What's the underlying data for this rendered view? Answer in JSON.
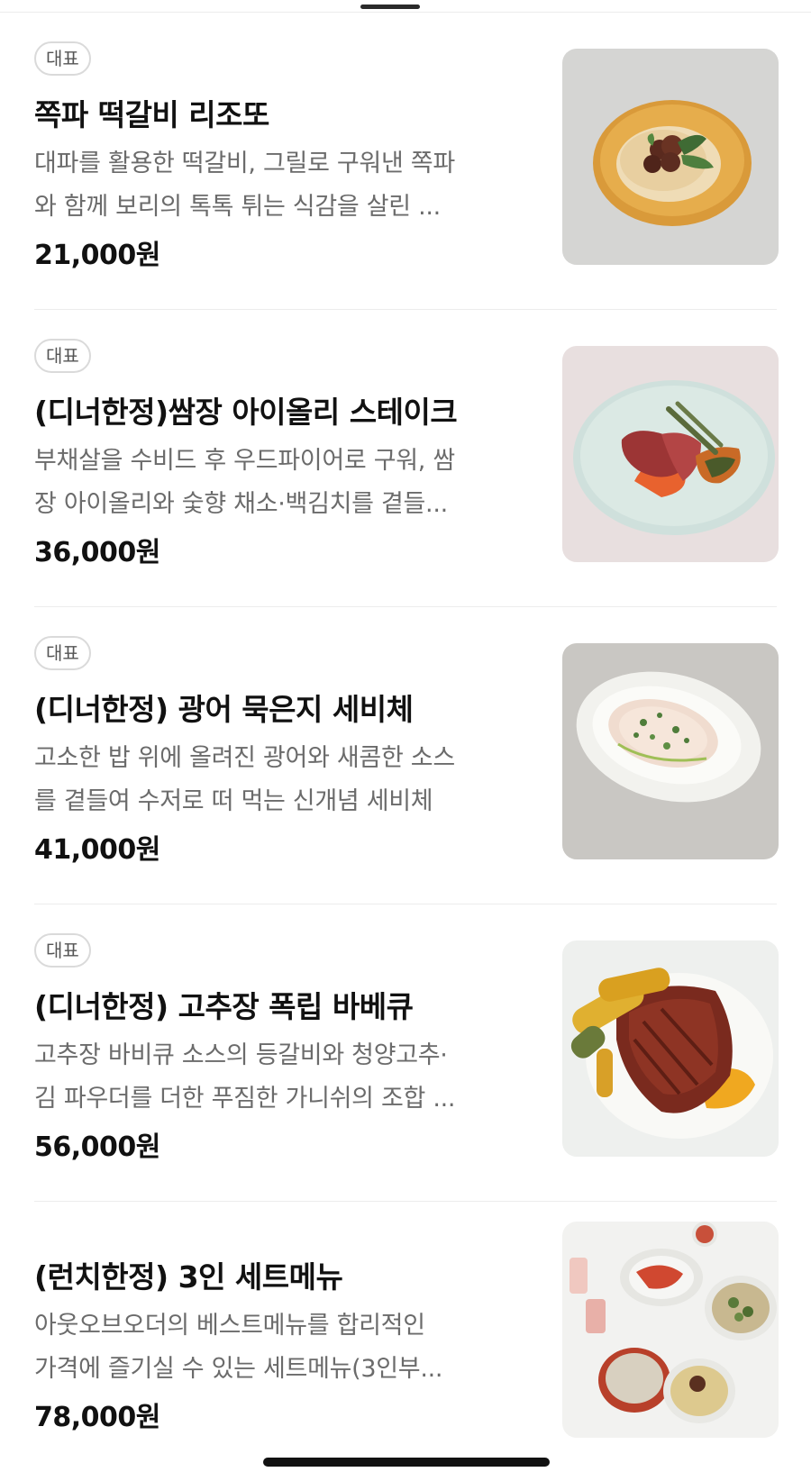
{
  "menu": {
    "items": [
      {
        "badge": "대표",
        "name": "쪽파 떡갈비 리조또",
        "desc_line1": "대파를 활용한 떡갈비, 그릴로 구워낸 쪽파",
        "desc_line2": "와 함께 보리의 톡톡 튀는 식감을 살린 ...",
        "price": "21,000원"
      },
      {
        "badge": "대표",
        "name": "(디너한정)쌈장 아이올리 스테이크",
        "desc_line1": "부채살을 수비드 후 우드파이어로 구워, 쌈",
        "desc_line2": "장 아이올리와 숯향 채소·백김치를 곁들...",
        "price": "36,000원"
      },
      {
        "badge": "대표",
        "name": "(디너한정) 광어 묵은지 세비체",
        "desc_line1": "고소한 밥 위에 올려진 광어와 새콤한 소스",
        "desc_line2": "를 곁들여 수저로 떠 먹는 신개념 세비체",
        "price": "41,000원"
      },
      {
        "badge": "대표",
        "name": "(디너한정) 고추장 폭립 바베큐",
        "desc_line1": "고추장 바비큐 소스의 등갈비와 청양고추·",
        "desc_line2": "김 파우더를 더한 푸짐한 가니쉬의 조합 ...",
        "price": "56,000원"
      },
      {
        "name": "(런치한정) 3인 세트메뉴",
        "desc_line1": "아웃오브오더의 베스트메뉴를 합리적인",
        "desc_line2": "가격에 즐기실 수 있는 세트메뉴(3인부...",
        "price": "78,000원"
      }
    ]
  }
}
